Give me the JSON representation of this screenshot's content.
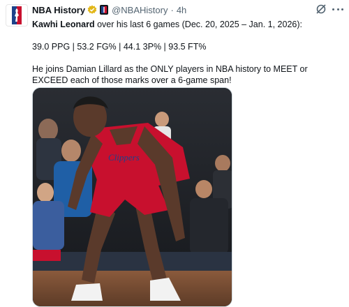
{
  "author": {
    "display_name": "NBA History",
    "handle": "@NBAHistory",
    "separator": "·",
    "time": "4h"
  },
  "tweet": {
    "line1_bold": "Kawhi Leonard",
    "line1_rest": " over his last 6 games (Dec. 20, 2025 – Jan. 1, 2026):",
    "stats": "39.0 PPG | 53.2 FG% | 44.1 3P% | 93.5 FT%",
    "paragraph": "He joins Damian Lillard as the ONLY players in NBA history to MEET or EXCEED each of those marks over a 6-game span!"
  },
  "media": {
    "jersey_text": "Clippers"
  },
  "icons": {
    "avatar": "nba-logo-icon",
    "verified": "gold-verified-badge-icon",
    "affiliate": "nba-affiliate-badge-icon",
    "grok": "grok-icon",
    "more": "more-dots-icon"
  },
  "colors": {
    "text": "#0f1419",
    "muted": "#536471",
    "verified_gold": "#e2b719",
    "jersey_red": "#c8102e",
    "jersey_blue": "#1d428a"
  }
}
